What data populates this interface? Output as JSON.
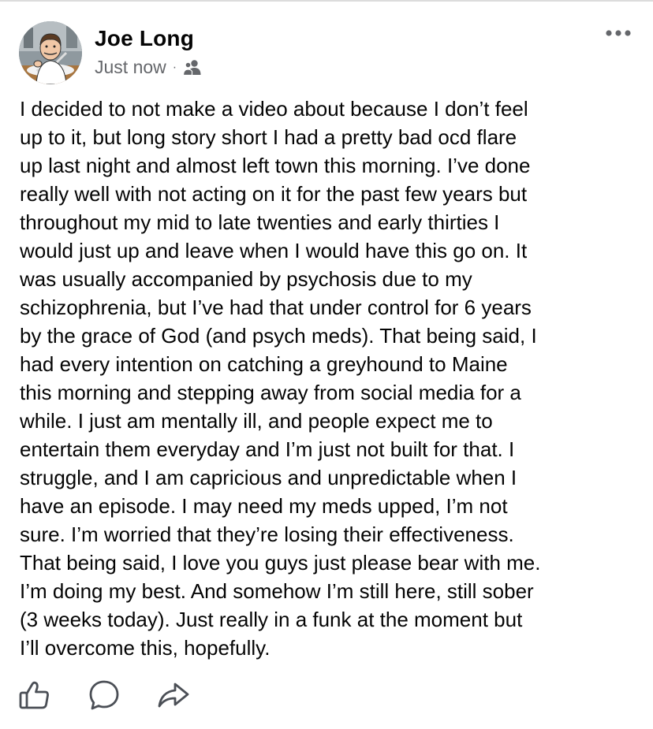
{
  "post": {
    "author": "Joe Long",
    "timestamp": "Just now",
    "separator": "·",
    "audience_icon": "friends-icon",
    "more_icon": "more-horizontal-icon",
    "body_lines": [
      "I decided to not make a video about because I don’t feel",
      "up to it, but long story short I had a pretty bad ocd flare",
      "up last night and almost left town this morning. I’ve done",
      "really well with not acting on it for the past few years but",
      "throughout my mid to late twenties and early thirties I",
      "would just up and leave when I would have this go on. It",
      "was usually accompanied by psychosis due to my",
      "schizophrenia, but I’ve had that under control for 6 years",
      "by the grace of God (and psych meds). That being said, I",
      "had every intention on catching a greyhound to Maine",
      "this morning and stepping away from social media for a",
      "while. I just am mentally ill, and people expect me to",
      "entertain them everyday and I’m just not built for that. I",
      "struggle, and I am capricious and unpredictable when I",
      "have an episode. I may need my meds upped, I’m not",
      "sure. I’m worried that they’re losing their effectiveness.",
      "That being said, I love you guys just please bear with me.",
      "I’m doing my best. And somehow I’m still here, still sober",
      "(3 weeks today). Just really in a funk at the moment but",
      "I’ll overcome this, hopefully."
    ]
  },
  "actions": {
    "like_icon": "thumbs-up-icon",
    "comment_icon": "comment-icon",
    "share_icon": "share-icon"
  },
  "colors": {
    "text": "#050505",
    "secondary": "#65676b",
    "icon": "#4b4f56"
  }
}
